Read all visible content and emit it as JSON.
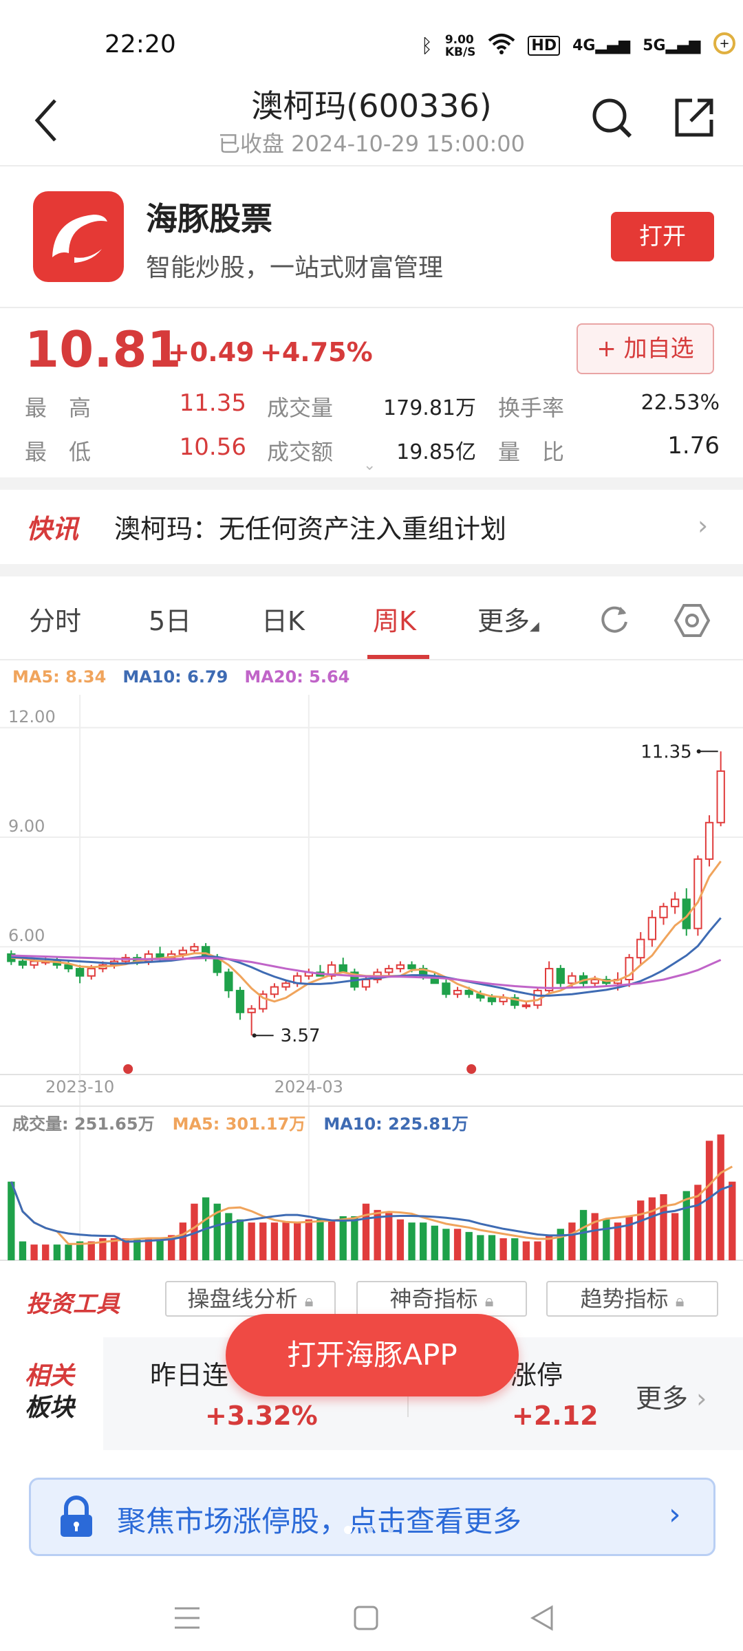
{
  "status": {
    "time": "22:20",
    "net_speed": "9.00",
    "net_unit": "KB/S",
    "hd": "HD",
    "sig1": "4G",
    "sig2": "5G"
  },
  "header": {
    "title": "澳柯玛(600336)",
    "subtitle": "已收盘 2024-10-29 15:00:00"
  },
  "promo": {
    "name": "海豚股票",
    "desc": "智能炒股，一站式财富管理",
    "open_label": "打开"
  },
  "quote": {
    "price": "10.81",
    "change": "+0.49",
    "change_pct": "+4.75%",
    "watch_label": "+ 加自选",
    "rows": [
      {
        "l1": "最　高",
        "v1": "11.35",
        "l2": "成交量",
        "v2": "179.81万",
        "l3": "换手率",
        "v3": "22.53%"
      },
      {
        "l1": "最　低",
        "v1": "10.56",
        "l2": "成交额",
        "v2": "19.85亿",
        "l3": "量　比",
        "v3": "1.76"
      }
    ]
  },
  "news": {
    "tag": "快讯",
    "text": "澳柯玛：无任何资产注入重组计划"
  },
  "tabs": {
    "items": [
      "分时",
      "5日",
      "日K",
      "周K",
      "更多"
    ],
    "active": "周K"
  },
  "ma_legend": {
    "ma5": "MA5: 8.34",
    "ma10": "MA10: 6.79",
    "ma20": "MA20: 5.64"
  },
  "chart_data": {
    "type": "candlestick",
    "y_ticks": [
      "12.00",
      "9.00",
      "6.00"
    ],
    "ylim": [
      2.5,
      12.9
    ],
    "x_ticks": [
      {
        "label": "2023-10",
        "index": 6
      },
      {
        "label": "2024-03",
        "index": 26
      }
    ],
    "annotations": [
      {
        "label": "11.35",
        "type": "max"
      },
      {
        "label": "3.57",
        "type": "min"
      }
    ],
    "colors": {
      "up": "#e03c3c",
      "down": "#1fa14a",
      "ma5": "#f0a45c",
      "ma10": "#3e6bb3",
      "ma20": "#c064c8"
    },
    "candles": [
      [
        5.8,
        5.9,
        5.5,
        5.6
      ],
      [
        5.6,
        5.7,
        5.4,
        5.5
      ],
      [
        5.5,
        5.7,
        5.4,
        5.6
      ],
      [
        5.6,
        5.7,
        5.5,
        5.6
      ],
      [
        5.6,
        5.7,
        5.4,
        5.5
      ],
      [
        5.5,
        5.6,
        5.3,
        5.4
      ],
      [
        5.4,
        5.5,
        5.0,
        5.2
      ],
      [
        5.2,
        5.5,
        5.1,
        5.4
      ],
      [
        5.4,
        5.6,
        5.3,
        5.5
      ],
      [
        5.5,
        5.7,
        5.4,
        5.6
      ],
      [
        5.6,
        5.8,
        5.5,
        5.7
      ],
      [
        5.7,
        5.8,
        5.5,
        5.6
      ],
      [
        5.6,
        5.9,
        5.5,
        5.8
      ],
      [
        5.8,
        6.0,
        5.6,
        5.7
      ],
      [
        5.7,
        5.9,
        5.6,
        5.8
      ],
      [
        5.8,
        6.0,
        5.7,
        5.9
      ],
      [
        5.9,
        6.1,
        5.8,
        6.0
      ],
      [
        6.0,
        6.1,
        5.6,
        5.7
      ],
      [
        5.7,
        5.8,
        5.2,
        5.3
      ],
      [
        5.3,
        5.4,
        4.6,
        4.8
      ],
      [
        4.8,
        4.9,
        4.0,
        4.2
      ],
      [
        4.2,
        4.4,
        3.57,
        4.3
      ],
      [
        4.3,
        4.8,
        4.2,
        4.7
      ],
      [
        4.7,
        5.0,
        4.6,
        4.9
      ],
      [
        4.9,
        5.1,
        4.8,
        5.0
      ],
      [
        5.0,
        5.3,
        4.9,
        5.2
      ],
      [
        5.2,
        5.4,
        5.1,
        5.3
      ],
      [
        5.3,
        5.5,
        5.2,
        5.2
      ],
      [
        5.2,
        5.6,
        5.1,
        5.5
      ],
      [
        5.5,
        5.7,
        5.3,
        5.3
      ],
      [
        5.3,
        5.4,
        4.8,
        4.9
      ],
      [
        4.9,
        5.2,
        4.8,
        5.1
      ],
      [
        5.1,
        5.4,
        5.0,
        5.3
      ],
      [
        5.3,
        5.5,
        5.2,
        5.4
      ],
      [
        5.4,
        5.6,
        5.3,
        5.5
      ],
      [
        5.5,
        5.6,
        5.3,
        5.4
      ],
      [
        5.4,
        5.5,
        5.1,
        5.2
      ],
      [
        5.2,
        5.3,
        5.0,
        5.0
      ],
      [
        5.0,
        5.1,
        4.6,
        4.7
      ],
      [
        4.7,
        4.9,
        4.6,
        4.8
      ],
      [
        4.8,
        4.9,
        4.6,
        4.7
      ],
      [
        4.7,
        4.8,
        4.5,
        4.6
      ],
      [
        4.6,
        4.7,
        4.4,
        4.5
      ],
      [
        4.5,
        4.7,
        4.4,
        4.6
      ],
      [
        4.6,
        4.7,
        4.3,
        4.4
      ],
      [
        4.4,
        4.5,
        4.3,
        4.4
      ],
      [
        4.4,
        4.9,
        4.3,
        4.8
      ],
      [
        4.8,
        5.6,
        4.7,
        5.4
      ],
      [
        5.4,
        5.5,
        4.9,
        5.0
      ],
      [
        5.0,
        5.3,
        4.9,
        5.2
      ],
      [
        5.2,
        5.3,
        4.9,
        5.0
      ],
      [
        5.0,
        5.2,
        4.9,
        5.1
      ],
      [
        5.1,
        5.2,
        4.9,
        5.0
      ],
      [
        5.0,
        5.3,
        4.8,
        5.1
      ],
      [
        5.1,
        5.8,
        4.9,
        5.7
      ],
      [
        5.7,
        6.4,
        5.5,
        6.2
      ],
      [
        6.2,
        7.0,
        6.0,
        6.8
      ],
      [
        6.8,
        7.2,
        6.6,
        7.1
      ],
      [
        7.1,
        7.5,
        6.9,
        7.3
      ],
      [
        7.3,
        7.6,
        6.3,
        6.5
      ],
      [
        6.5,
        8.5,
        6.3,
        8.4
      ],
      [
        8.4,
        9.6,
        8.2,
        9.4
      ],
      [
        9.4,
        11.35,
        9.3,
        10.81
      ]
    ],
    "ma5": [
      5.7,
      5.68,
      5.62,
      5.6,
      5.58,
      5.54,
      5.46,
      5.44,
      5.46,
      5.48,
      5.52,
      5.6,
      5.66,
      5.68,
      5.72,
      5.76,
      5.82,
      5.82,
      5.7,
      5.5,
      5.2,
      4.86,
      4.6,
      4.5,
      4.6,
      4.8,
      5.0,
      5.12,
      5.24,
      5.3,
      5.24,
      5.2,
      5.2,
      5.2,
      5.2,
      5.36,
      5.38,
      5.3,
      5.16,
      4.98,
      4.86,
      4.72,
      4.64,
      4.62,
      4.56,
      4.5,
      4.54,
      4.72,
      4.8,
      4.96,
      5.08,
      5.14,
      5.06,
      5.08,
      5.22,
      5.5,
      5.76,
      6.18,
      6.58,
      6.82,
      7.22,
      7.92,
      8.34
    ],
    "ma10": [
      5.72,
      5.7,
      5.68,
      5.66,
      5.64,
      5.62,
      5.6,
      5.58,
      5.56,
      5.54,
      5.54,
      5.56,
      5.58,
      5.6,
      5.62,
      5.66,
      5.7,
      5.74,
      5.72,
      5.66,
      5.56,
      5.44,
      5.3,
      5.18,
      5.08,
      5.0,
      4.98,
      4.98,
      5.0,
      5.04,
      5.08,
      5.12,
      5.14,
      5.18,
      5.2,
      5.22,
      5.22,
      5.2,
      5.16,
      5.1,
      5.04,
      4.98,
      4.92,
      4.86,
      4.78,
      4.72,
      4.66,
      4.66,
      4.68,
      4.7,
      4.74,
      4.78,
      4.82,
      4.88,
      4.96,
      5.06,
      5.2,
      5.36,
      5.56,
      5.76,
      6.02,
      6.42,
      6.79
    ],
    "ma20": [
      5.76,
      5.75,
      5.74,
      5.73,
      5.72,
      5.71,
      5.7,
      5.69,
      5.68,
      5.67,
      5.66,
      5.66,
      5.66,
      5.66,
      5.66,
      5.67,
      5.68,
      5.69,
      5.68,
      5.66,
      5.62,
      5.58,
      5.52,
      5.46,
      5.4,
      5.35,
      5.3,
      5.26,
      5.24,
      5.22,
      5.2,
      5.19,
      5.18,
      5.18,
      5.18,
      5.17,
      5.16,
      5.15,
      5.13,
      5.1,
      5.06,
      5.02,
      4.98,
      4.95,
      4.92,
      4.9,
      4.88,
      4.87,
      4.87,
      4.88,
      4.89,
      4.9,
      4.92,
      4.94,
      4.97,
      5.0,
      5.05,
      5.1,
      5.18,
      5.26,
      5.36,
      5.5,
      5.64
    ],
    "volume": [
      0.25,
      0.06,
      0.05,
      0.05,
      0.05,
      0.05,
      0.06,
      0.06,
      0.07,
      0.07,
      0.07,
      0.07,
      0.07,
      0.07,
      0.08,
      0.12,
      0.18,
      0.2,
      0.18,
      0.15,
      0.13,
      0.12,
      0.12,
      0.12,
      0.12,
      0.12,
      0.13,
      0.13,
      0.13,
      0.14,
      0.14,
      0.18,
      0.16,
      0.15,
      0.13,
      0.12,
      0.12,
      0.11,
      0.1,
      0.1,
      0.09,
      0.08,
      0.08,
      0.07,
      0.07,
      0.06,
      0.06,
      0.08,
      0.1,
      0.12,
      0.16,
      0.15,
      0.13,
      0.12,
      0.14,
      0.19,
      0.2,
      0.21,
      0.15,
      0.22,
      0.24,
      0.38,
      0.4,
      0.25
    ]
  },
  "vol_legend": {
    "total": "成交量: 251.65万",
    "ma5": "MA5: 301.17万",
    "ma10": "MA10: 225.81万"
  },
  "tools": {
    "title": "投资工具",
    "buttons": [
      "操盘线分析",
      "神奇指标",
      "趋势指标"
    ]
  },
  "sectors": {
    "title_line1": "相关",
    "title_line2": "板块",
    "items": [
      {
        "name": "昨日连",
        "value": "+3.32%"
      },
      {
        "name": "涨停",
        "value": "+2.12"
      }
    ],
    "more": "更多"
  },
  "open_app": "打开海豚APP",
  "banner": {
    "text": "聚焦市场涨停股，点击查看更多"
  }
}
